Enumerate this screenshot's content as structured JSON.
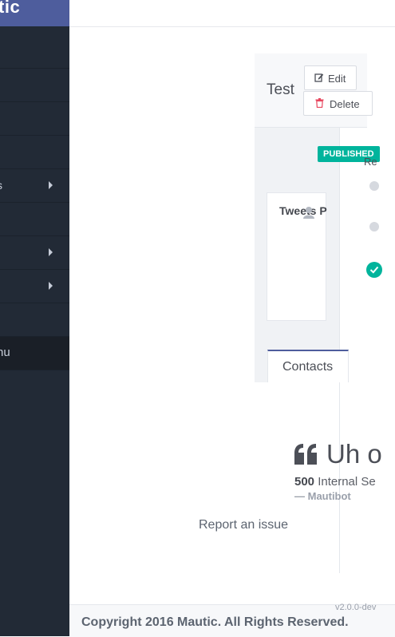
{
  "brand": {
    "logo_text": "tic"
  },
  "sidebar": {
    "items": [
      {
        "label": ""
      },
      {
        "label": ""
      },
      {
        "label": ""
      },
      {
        "label": ""
      },
      {
        "label": "s"
      },
      {
        "label": ""
      },
      {
        "label": ""
      },
      {
        "label": ""
      },
      {
        "label": ""
      },
      {
        "label": "nu"
      }
    ]
  },
  "header": {
    "title": "Test",
    "edit_label": "Edit",
    "delete_label": "Delete"
  },
  "status": {
    "badge": "PUBLISHED",
    "recent_heading": "Re"
  },
  "card": {
    "title": "Tweets P"
  },
  "tabs": [
    {
      "label": "Contacts"
    }
  ],
  "error": {
    "heading": "Uh o",
    "code": "500",
    "message": "Internal Se",
    "attribution": "— Mautibot",
    "report_link": "Report an issue"
  },
  "footer": {
    "version": "v2.0.0-dev",
    "copyright": "Copyright 2016 Mautic. All Rights Reserved."
  },
  "colors": {
    "sidebar_bg": "#222a36",
    "brand_bg": "#4e5d9d",
    "accent_teal": "#00b49c",
    "danger": "#e8465e"
  },
  "icons": [
    "edit-icon",
    "trash-icon",
    "user-icon",
    "check-icon",
    "quote-icon",
    "chevron-right-icon"
  ]
}
